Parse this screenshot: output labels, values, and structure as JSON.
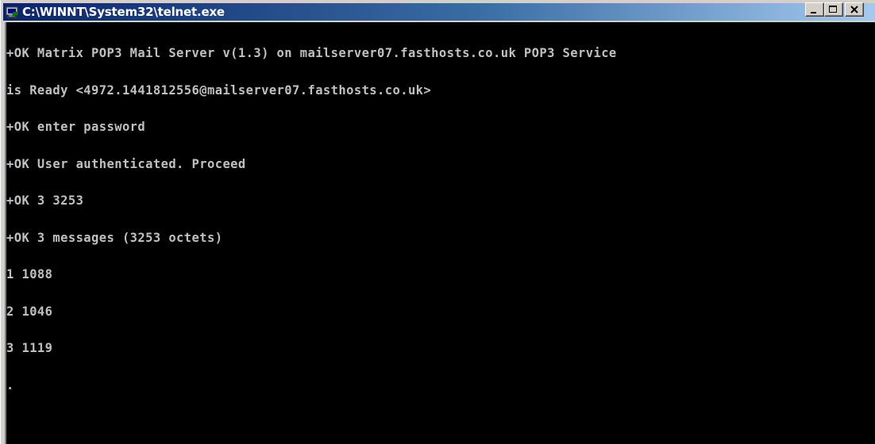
{
  "window": {
    "title": "C:\\WINNT\\System32\\telnet.exe",
    "icon": "console-app-icon",
    "buttons": {
      "minimize": "minimize-icon",
      "maximize": "maximize-icon",
      "close": "close-icon"
    }
  },
  "console": {
    "lines": [
      "+OK Matrix POP3 Mail Server v(1.3) on mailserver07.fasthosts.co.uk POP3 Service",
      "is Ready <4972.1441812556@mailserver07.fasthosts.co.uk>",
      "+OK enter password",
      "+OK User authenticated. Proceed",
      "+OK 3 3253",
      "+OK 3 messages (3253 octets)",
      "1 1088",
      "2 1046",
      "3 1119"
    ],
    "terminator": "."
  },
  "colors": {
    "background": "#000000",
    "text": "#c0c0c0",
    "titlebar_start": "#0a246a",
    "titlebar_end": "#a6caf0"
  }
}
